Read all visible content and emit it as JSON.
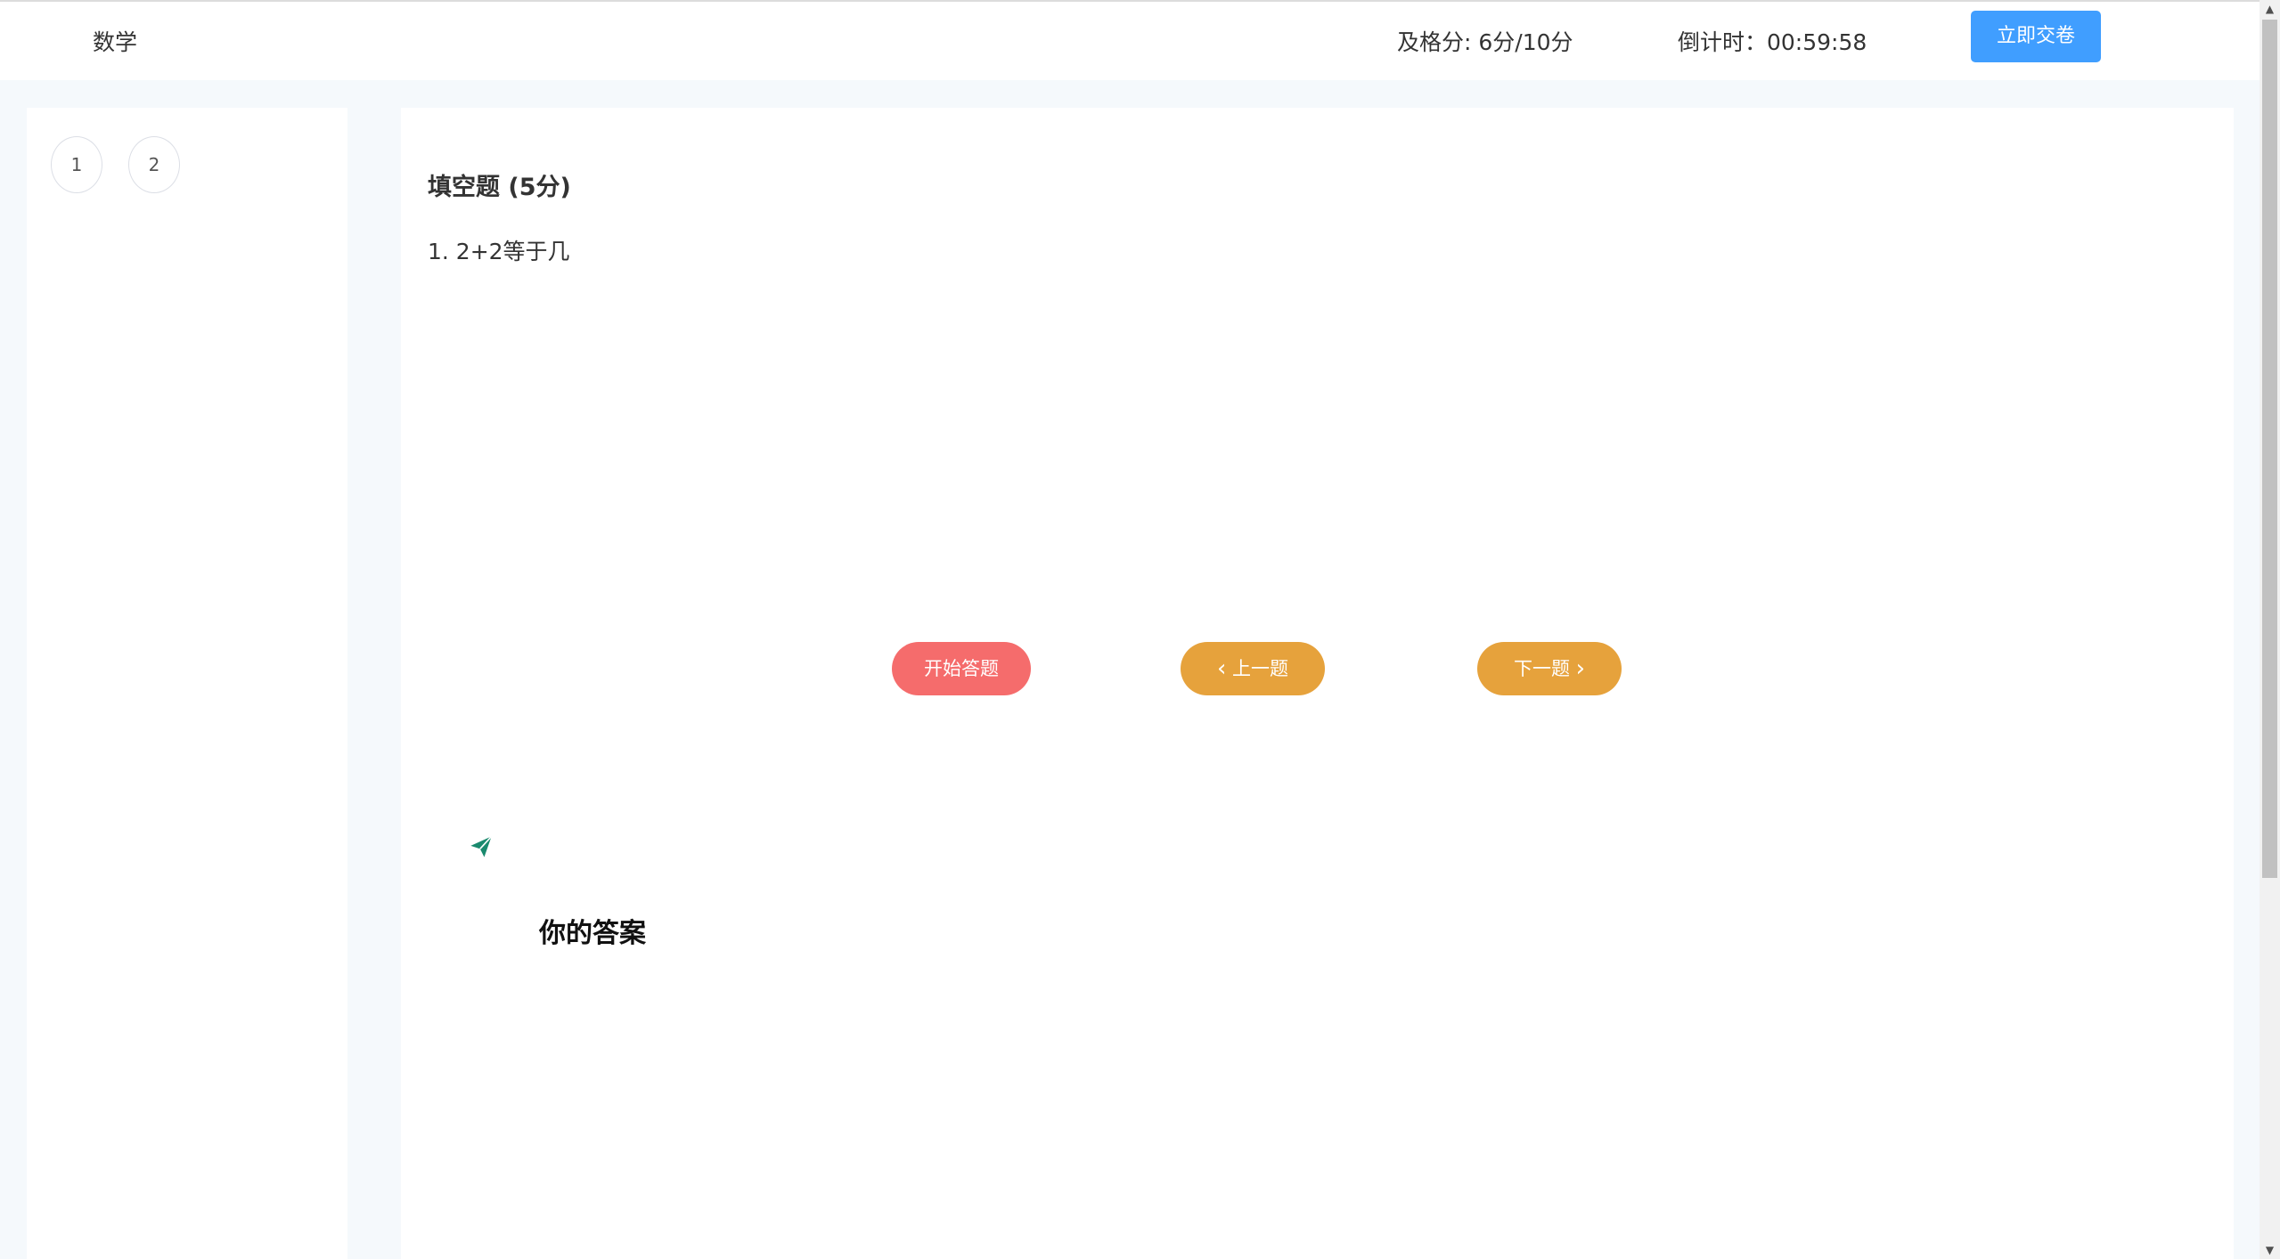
{
  "header": {
    "subject": "数学",
    "pass_score": "及格分: 6分/10分",
    "countdown": "倒计时：00:59:58",
    "submit_label": "立即交卷"
  },
  "question_nav": {
    "items": [
      "1",
      "2"
    ]
  },
  "question": {
    "type_label": "填空题 (5分)",
    "text": "1. 2+2等于几"
  },
  "actions": {
    "start_label": "开始答题",
    "prev_label": "上一题",
    "next_label": "下一题"
  },
  "answer": {
    "title": "你的答案"
  },
  "icons": {
    "send": "paper-plane-icon",
    "prev": "chevron-left-icon",
    "next": "chevron-right-icon"
  },
  "colors": {
    "primary": "#409eff",
    "danger": "#f56c6c",
    "warning": "#e6a23c",
    "send_icon": "#1a8a6e"
  }
}
